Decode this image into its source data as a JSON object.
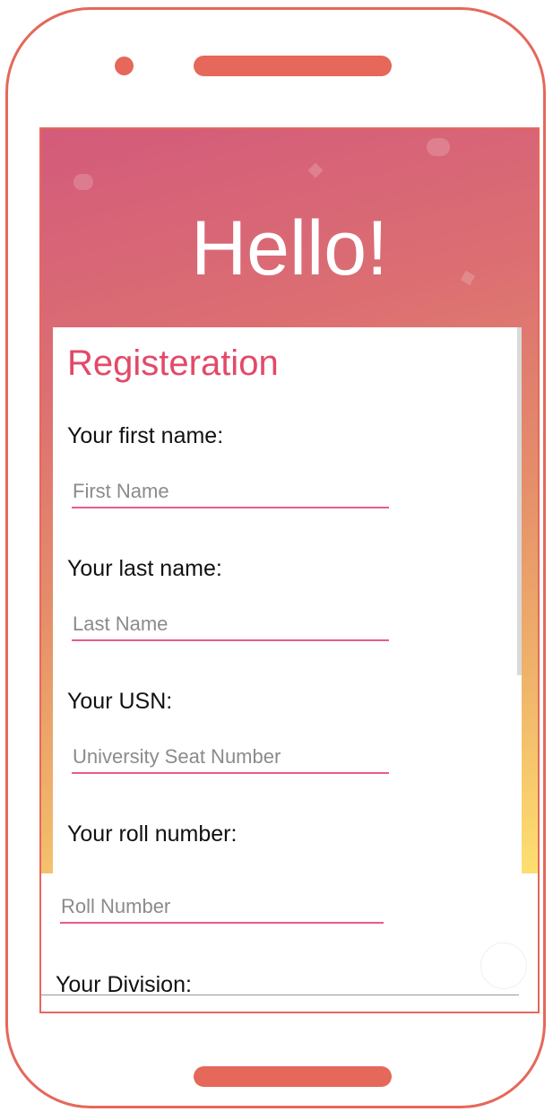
{
  "header": {
    "title": "Hello!"
  },
  "form": {
    "title": "Registeration",
    "fields": [
      {
        "label": "Your first name:",
        "placeholder": "First Name"
      },
      {
        "label": "Your last name:",
        "placeholder": "Last Name"
      },
      {
        "label": "Your USN:",
        "placeholder": "University Seat Number"
      },
      {
        "label": "Your roll number:",
        "placeholder": "Roll Number"
      },
      {
        "label": "Your Division:"
      }
    ]
  },
  "colors": {
    "frame": "#e5685b",
    "accent": "#e24a68",
    "input_underline": "#e95c86",
    "gradient_top": "#d35b7b",
    "gradient_bottom": "#fde070"
  }
}
